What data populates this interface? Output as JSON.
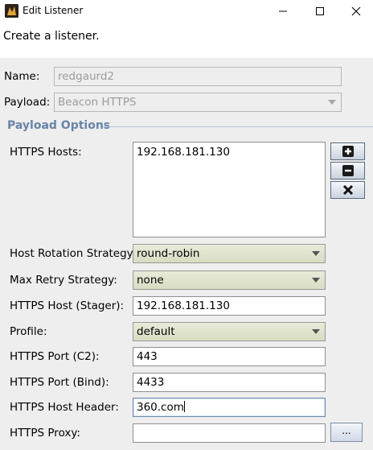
{
  "window": {
    "title": "Edit Listener"
  },
  "header": {
    "description": "Create a listener."
  },
  "fields": {
    "name_label": "Name:",
    "name_value": "redgaurd2",
    "payload_label": "Payload:",
    "payload_value": "Beacon HTTPS"
  },
  "section": {
    "title": "Payload Options"
  },
  "options": {
    "hosts_label": "HTTPS Hosts:",
    "hosts": [
      "192.168.181.130"
    ],
    "rotation_label": "Host Rotation Strategy:",
    "rotation_value": "round-robin",
    "retry_label": "Max Retry Strategy:",
    "retry_value": "none",
    "stager_label": "HTTPS Host (Stager):",
    "stager_value": "192.168.181.130",
    "profile_label": "Profile:",
    "profile_value": "default",
    "port_c2_label": "HTTPS Port (C2):",
    "port_c2_value": "443",
    "port_bind_label": "HTTPS Port (Bind):",
    "port_bind_value": "4433",
    "host_header_label": "HTTPS Host Header:",
    "host_header_value": "360.com",
    "proxy_label": "HTTPS Proxy:",
    "proxy_value": "",
    "proxy_button": "..."
  },
  "colors": {
    "section_title": "#6784a9",
    "combo_bg": "#e2e6d1"
  }
}
